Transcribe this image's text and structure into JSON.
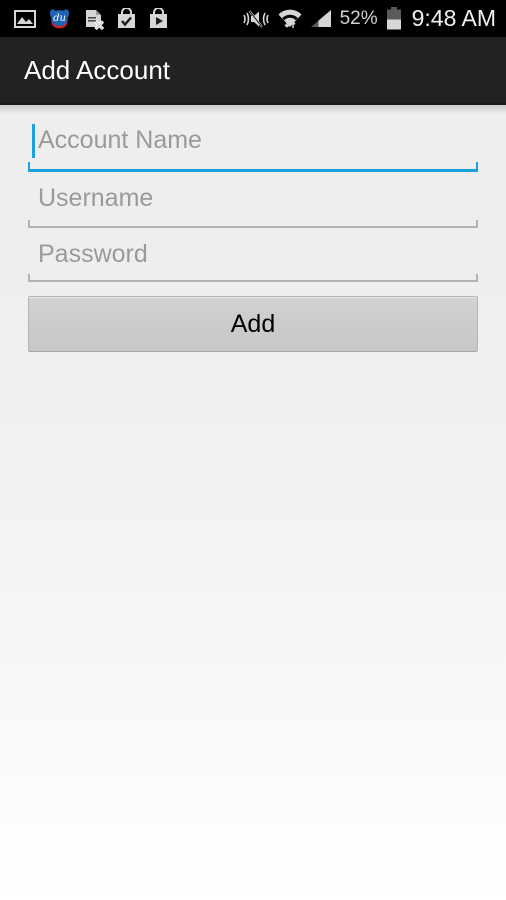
{
  "status_bar": {
    "left_icons": [
      {
        "name": "screenshot-image-icon",
        "label": "image"
      },
      {
        "name": "du-speed-booster-icon",
        "label": "du"
      },
      {
        "name": "document-removed-icon",
        "label": "document-x"
      },
      {
        "name": "app-installed-check-icon",
        "label": "check-bag"
      },
      {
        "name": "play-store-icon",
        "label": "play-bag"
      }
    ],
    "right_icons": [
      {
        "name": "vibrate-mute-icon",
        "label": "mute"
      },
      {
        "name": "wifi-data-icon",
        "label": "wifi"
      },
      {
        "name": "cellular-signal-icon",
        "label": "signal"
      },
      {
        "name": "battery-icon",
        "label": "battery"
      }
    ],
    "battery_percent": "52%",
    "clock": "9:48 AM"
  },
  "action_bar": {
    "title": "Add Account"
  },
  "form": {
    "fields": [
      {
        "name": "account-name",
        "placeholder": "Account Name",
        "value": "",
        "focused": true
      },
      {
        "name": "username",
        "placeholder": "Username",
        "value": "",
        "focused": false
      },
      {
        "name": "password",
        "placeholder": "Password",
        "value": "",
        "focused": false
      }
    ],
    "submit_label": "Add"
  },
  "colors": {
    "status_bar_bg": "#000000",
    "action_bar_bg": "#222222",
    "accent_focus": "#1ba1dd",
    "underline_idle": "#b3b3b3",
    "placeholder_text": "#9a9a9a",
    "button_bg": "#cccccc",
    "page_bg_top": "#eeeeee",
    "page_bg_bottom": "#ffffff"
  }
}
